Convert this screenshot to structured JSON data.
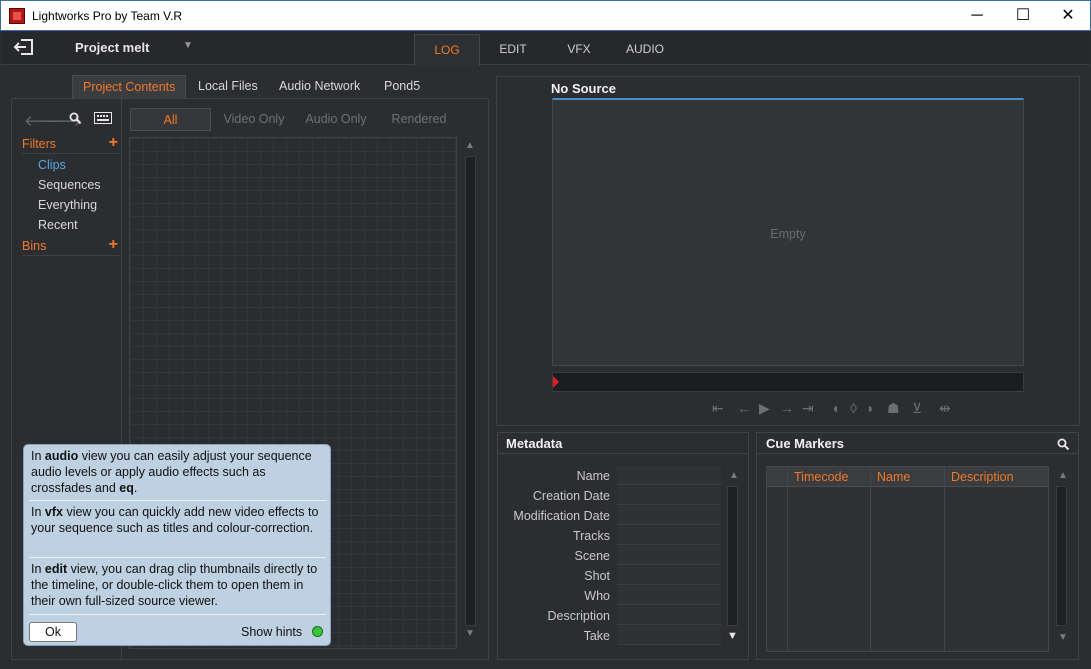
{
  "window": {
    "title": "Lightworks Pro by Team V.R",
    "minimize_glyph": "─",
    "maximize_glyph": "☐",
    "close_glyph": "✕"
  },
  "appbar": {
    "project_name": "Project melt",
    "project_dropdown_glyph": "▼",
    "tabs": [
      "LOG",
      "EDIT",
      "VFX",
      "AUDIO"
    ],
    "active_tab": "LOG"
  },
  "left_panel": {
    "tabs": [
      "Project Contents",
      "Local Files",
      "Audio Network",
      "Pond5"
    ],
    "active_tab": "Project Contents",
    "toolbar_icons": [
      "back-arrow-icon",
      "forward-arrow-icon",
      "search-icon",
      "keyboard-icon"
    ],
    "filters_label": "Filters",
    "filter_items": [
      "Clips",
      "Sequences",
      "Everything",
      "Recent"
    ],
    "active_filter": "Clips",
    "bins_label": "Bins",
    "view_tabs": [
      "All",
      "Video Only",
      "Audio Only",
      "Rendered"
    ],
    "active_view_tab": "All"
  },
  "hints": {
    "audio": {
      "pre": "In ",
      "kw": "audio",
      "mid": " view you can easily adjust your sequence audio levels or apply audio effects such as crossfades and ",
      "kw2": "eq",
      "post": "."
    },
    "vfx": {
      "pre": "In ",
      "kw": "vfx",
      "post": " view you can quickly add new video effects to your sequence such as titles and colour-correction."
    },
    "edit": {
      "pre": "In ",
      "kw": "edit",
      "post": " view, you can drag clip thumbnails directly to the timeline, or double-click them to open them in their own full-sized source viewer."
    },
    "ok_label": "Ok",
    "show_hints_label": "Show hints",
    "show_hints_on": true
  },
  "viewer": {
    "source_title": "No Source",
    "empty_label": "Empty",
    "transport_icons": [
      "go-to-start-icon",
      "step-back-icon",
      "play-icon",
      "step-forward-icon",
      "go-to-end-icon",
      "mark-in-icon",
      "mark-clear-icon",
      "mark-out-icon",
      "mark-record-icon",
      "insert-icon",
      "replace-icon"
    ]
  },
  "metadata": {
    "title": "Metadata",
    "fields": [
      "Name",
      "Creation Date",
      "Modification Date",
      "Tracks",
      "Scene",
      "Shot",
      "Who",
      "Description",
      "Take"
    ]
  },
  "cue_markers": {
    "title": "Cue Markers",
    "columns": [
      "Timecode",
      "Name",
      "Description"
    ]
  },
  "colors": {
    "accent_orange": "#f07a28",
    "active_filter_blue": "#5aa8e0",
    "hints_background": "#bdd1e2"
  }
}
